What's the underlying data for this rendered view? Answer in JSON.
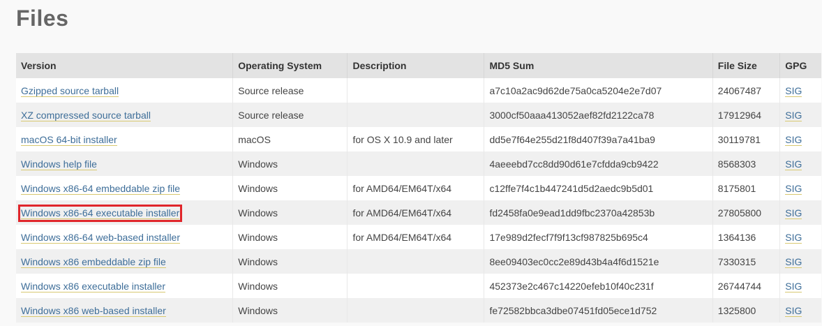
{
  "heading": "Files",
  "columns": {
    "version": "Version",
    "os": "Operating System",
    "description": "Description",
    "md5": "MD5 Sum",
    "size": "File Size",
    "gpg": "GPG"
  },
  "rows": [
    {
      "version": "Gzipped source tarball",
      "os": "Source release",
      "description": "",
      "md5": "a7c10a2ac9d62de75a0ca5204e2e7d07",
      "size": "24067487",
      "gpg": "SIG"
    },
    {
      "version": "XZ compressed source tarball",
      "os": "Source release",
      "description": "",
      "md5": "3000cf50aaa413052aef82fd2122ca78",
      "size": "17912964",
      "gpg": "SIG"
    },
    {
      "version": "macOS 64-bit installer",
      "os": "macOS",
      "description": "for OS X 10.9 and later",
      "md5": "dd5e7f64e255d21f8d407f39a7a41ba9",
      "size": "30119781",
      "gpg": "SIG"
    },
    {
      "version": "Windows help file",
      "os": "Windows",
      "description": "",
      "md5": "4aeeebd7cc8dd90d61e7cfdda9cb9422",
      "size": "8568303",
      "gpg": "SIG"
    },
    {
      "version": "Windows x86-64 embeddable zip file",
      "os": "Windows",
      "description": "for AMD64/EM64T/x64",
      "md5": "c12ffe7f4c1b447241d5d2aedc9b5d01",
      "size": "8175801",
      "gpg": "SIG"
    },
    {
      "version": "Windows x86-64 executable installer",
      "os": "Windows",
      "description": "for AMD64/EM64T/x64",
      "md5": "fd2458fa0e9ead1dd9fbc2370a42853b",
      "size": "27805800",
      "gpg": "SIG"
    },
    {
      "version": "Windows x86-64 web-based installer",
      "os": "Windows",
      "description": "for AMD64/EM64T/x64",
      "md5": "17e989d2fecf7f9f13cf987825b695c4",
      "size": "1364136",
      "gpg": "SIG"
    },
    {
      "version": "Windows x86 embeddable zip file",
      "os": "Windows",
      "description": "",
      "md5": "8ee09403ec0cc2e89d43b4a4f6d1521e",
      "size": "7330315",
      "gpg": "SIG"
    },
    {
      "version": "Windows x86 executable installer",
      "os": "Windows",
      "description": "",
      "md5": "452373e2c467c14220efeb10f40c231f",
      "size": "26744744",
      "gpg": "SIG"
    },
    {
      "version": "Windows x86 web-based installer",
      "os": "Windows",
      "description": "",
      "md5": "fe72582bbca3dbe07451fd05ece1d752",
      "size": "1325800",
      "gpg": "SIG"
    }
  ],
  "highlight_color": "#e0262b",
  "link_color": "#3e6e99"
}
